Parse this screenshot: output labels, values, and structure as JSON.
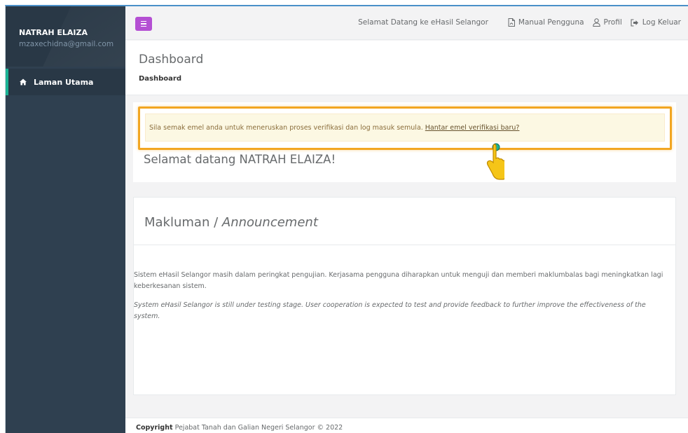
{
  "user": {
    "name": "NATRAH ELAIZA",
    "email": "mzaxechidna@gmail.com"
  },
  "sidebar": {
    "items": [
      {
        "label": "Laman Utama",
        "icon": "home-icon",
        "active": true
      }
    ],
    "active_accent": "#1ab394"
  },
  "topbar": {
    "menu_icon": "hamburger-icon",
    "menu_button_color": "#b44fd3",
    "welcome": "Selamat Datang ke eHasil Selangor",
    "links": [
      {
        "label": "Manual Pengguna",
        "icon": "pdf-file-icon"
      },
      {
        "label": "Profil",
        "icon": "user-icon"
      },
      {
        "label": "Log Keluar",
        "icon": "sign-out-icon"
      }
    ]
  },
  "heading": {
    "title": "Dashboard",
    "breadcrumb": "Dashboard"
  },
  "alert": {
    "message": "Sila semak emel anda untuk meneruskan proses verifikasi dan log masuk semula.",
    "link": "Hantar emel verifikasi baru?",
    "highlight_color": "#f2a622"
  },
  "welcome_card": {
    "greeting": "Selamat datang NATRAH ELAIZA!"
  },
  "announcement": {
    "title_main": "Makluman / ",
    "title_italic": "Announcement",
    "body_ms": "Sistem eHasil Selangor masih dalam peringkat pengujian. Kerjasama pengguna diharapkan untuk menguji dan memberi maklumbalas bagi meningkatkan lagi keberkesanan sistem.",
    "body_en": "System eHasil Selangor is still under testing stage. User cooperation is expected to test and provide feedback to further improve the effectiveness of the system."
  },
  "footer": {
    "label": "Copyright",
    "text": " Pejabat Tanah dan Galian Negeri Selangor © 2022"
  }
}
